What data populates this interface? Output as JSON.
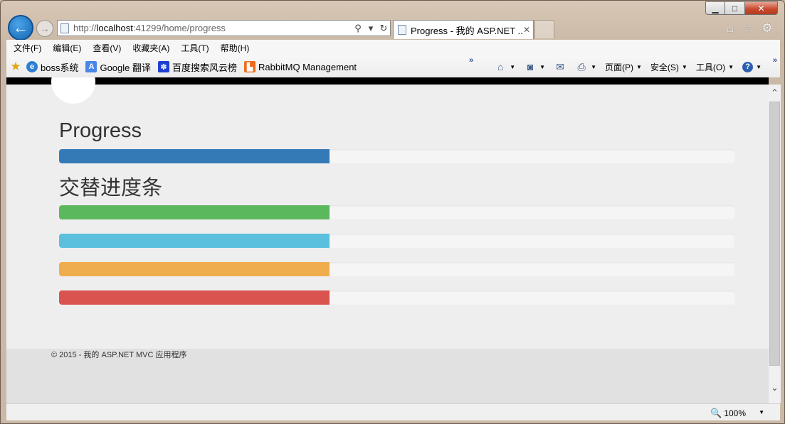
{
  "window": {
    "controls": {
      "minimize": "▁",
      "maximize": "□",
      "close": "✕"
    }
  },
  "nav": {
    "back_icon": "←",
    "forward_icon": "→",
    "address": {
      "prefix": "http://",
      "host": "localhost",
      "rest": ":41299/home/progress",
      "search_icon": "⚲",
      "dropdown_icon": "▾",
      "refresh_icon": "↻"
    },
    "tab": {
      "title": "Progress - 我的 ASP.NET ...",
      "close": "✕"
    },
    "right_icons": {
      "home": "⌂",
      "favorites": "☆",
      "tools": "⚙"
    }
  },
  "menubar": {
    "items": [
      "文件(F)",
      "编辑(E)",
      "查看(V)",
      "收藏夹(A)",
      "工具(T)",
      "帮助(H)"
    ]
  },
  "favorites": {
    "star_icon": "★",
    "items": [
      {
        "label": "boss系统",
        "icon": "e"
      },
      {
        "label": "Google 翻译",
        "icon": "A"
      },
      {
        "label": "百度搜索风云榜",
        "icon": "✽"
      },
      {
        "label": "RabbitMQ Management",
        "icon": "▙"
      }
    ],
    "chevron": "»"
  },
  "commandbar": {
    "home_icon": "⌂",
    "feeds_icon": "◙",
    "mail_icon": "✉",
    "print_icon": "⎙",
    "page_label": "页面(P)",
    "safety_label": "安全(S)",
    "tools_label": "工具(O)",
    "help_icon": "?",
    "dropdown": "▼",
    "chevron": "»"
  },
  "page": {
    "heading1": "Progress",
    "heading2": "交替进度条",
    "bars": [
      {
        "value": 40,
        "color": "#337ab7"
      },
      {
        "value": 40,
        "color": "#5cb85c"
      },
      {
        "value": 40,
        "color": "#5bc0de"
      },
      {
        "value": 40,
        "color": "#f0ad4e"
      },
      {
        "value": 40,
        "color": "#d9534f"
      }
    ],
    "footer": "© 2015 - 我的 ASP.NET MVC 应用程序"
  },
  "scrollbar": {
    "up": "⌃",
    "down": "⌄"
  },
  "statusbar": {
    "zoom_icon": "🔍",
    "zoom": "100%",
    "dropdown": "▼"
  }
}
